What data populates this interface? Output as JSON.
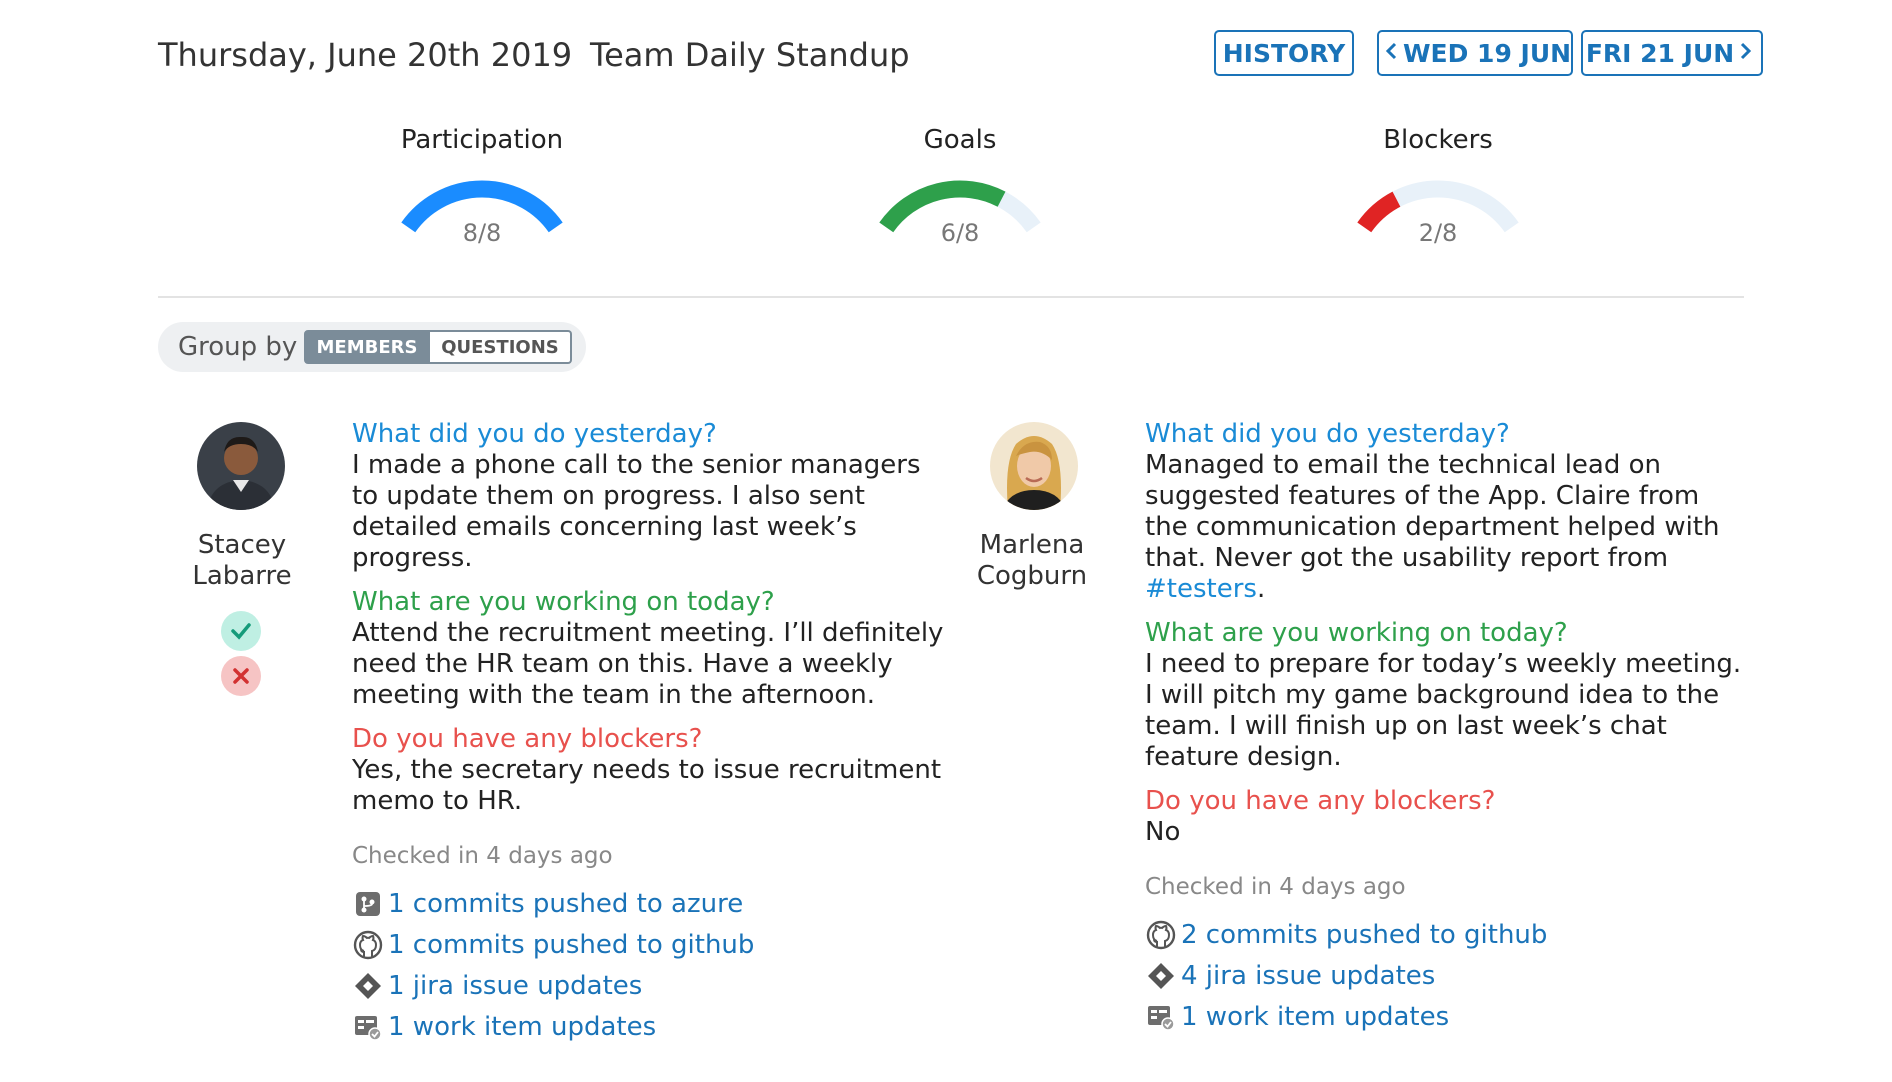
{
  "header": {
    "date": "Thursday, June 20th 2019",
    "title": "Team Daily Standup",
    "history_label": "HISTORY",
    "prev_label": "WED 19 JUN",
    "next_label": "FRI 21 JUN"
  },
  "gauges": [
    {
      "title": "Participation",
      "value_text": "8/8",
      "fraction": 1.0,
      "color": "#1a8cff"
    },
    {
      "title": "Goals",
      "value_text": "6/8",
      "fraction": 0.75,
      "color": "#2ea04b"
    },
    {
      "title": "Blockers",
      "value_text": "2/8",
      "fraction": 0.25,
      "color": "#e02424"
    }
  ],
  "gauge_track_color": "#e8f1f9",
  "group_by": {
    "label": "Group by",
    "options": [
      "MEMBERS",
      "QUESTIONS"
    ],
    "selected": "MEMBERS"
  },
  "members": [
    {
      "name_line1": "Stacey",
      "name_line2": "Labarre",
      "status_icons": [
        "check-icon",
        "cross-icon"
      ],
      "questions": [
        {
          "q": "What did you do yesterday?",
          "a": "I made a phone call to the senior managers to update them on progress. I also sent detailed emails concerning last week’s progress."
        },
        {
          "q": "What are you working on today?",
          "a": "Attend the recruitment meeting. I’ll definitely need the HR team on this. Have a weekly meeting with the team in the afternoon."
        },
        {
          "q": "Do you have any blockers?",
          "a": "Yes, the secretary needs to issue recruitment memo to HR."
        }
      ],
      "checked_in": "Checked in 4 days ago",
      "activities": [
        {
          "icon": "azure-repo-icon",
          "label": "1 commits pushed to azure"
        },
        {
          "icon": "github-icon",
          "label": "1 commits pushed to github"
        },
        {
          "icon": "jira-icon",
          "label": "1 jira issue updates"
        },
        {
          "icon": "work-item-icon",
          "label": "1 work item updates"
        }
      ]
    },
    {
      "name_line1": "Marlena",
      "name_line2": "Cogburn",
      "questions": [
        {
          "q": "What did you do yesterday?",
          "a_prefix": "Managed to email the technical lead on suggested features of the App. Claire from the communication department helped with that. Never got the usability report from ",
          "a_tag": "#testers",
          "a_suffix": "."
        },
        {
          "q": "What are you working on today?",
          "a": "I need to prepare for today’s weekly meeting. I will pitch my game background idea to the team. I will finish up on last week’s chat feature design."
        },
        {
          "q": "Do you have any blockers?",
          "a": "No"
        }
      ],
      "checked_in": "Checked in 4 days ago",
      "activities": [
        {
          "icon": "github-icon",
          "label": "2 commits pushed to github"
        },
        {
          "icon": "jira-icon",
          "label": "4 jira issue updates"
        },
        {
          "icon": "work-item-icon",
          "label": "1 work item updates"
        }
      ]
    }
  ]
}
